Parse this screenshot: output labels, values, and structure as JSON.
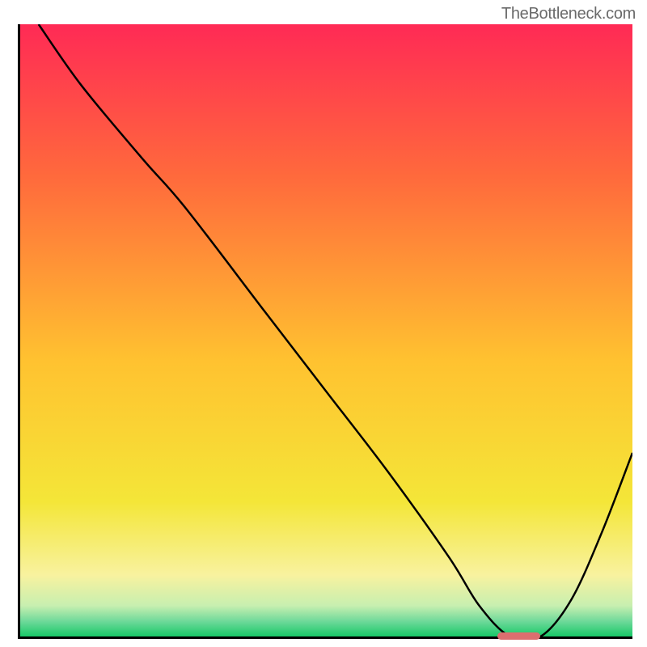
{
  "watermark": "TheBottleneck.com",
  "chart_data": {
    "type": "line",
    "title": "",
    "xlabel": "",
    "ylabel": "",
    "xlim": [
      0,
      100
    ],
    "ylim": [
      0,
      100
    ],
    "x": [
      3,
      10,
      20,
      27,
      40,
      50,
      60,
      70,
      75,
      80,
      85,
      90,
      95,
      100
    ],
    "y": [
      100,
      90,
      78,
      70,
      53,
      40,
      27,
      13,
      5,
      0,
      0,
      6,
      17,
      30
    ],
    "gradient_stops": [
      {
        "offset": 0.0,
        "color": "#ff2a55"
      },
      {
        "offset": 0.25,
        "color": "#ff6a3c"
      },
      {
        "offset": 0.55,
        "color": "#ffc230"
      },
      {
        "offset": 0.78,
        "color": "#f4e638"
      },
      {
        "offset": 0.9,
        "color": "#f8f29f"
      },
      {
        "offset": 0.95,
        "color": "#c7efb0"
      },
      {
        "offset": 0.975,
        "color": "#6fd99a"
      },
      {
        "offset": 1.0,
        "color": "#18c968"
      }
    ],
    "marker": {
      "x_start": 78,
      "x_end": 85,
      "y": 0,
      "color": "#db6e6f"
    }
  }
}
